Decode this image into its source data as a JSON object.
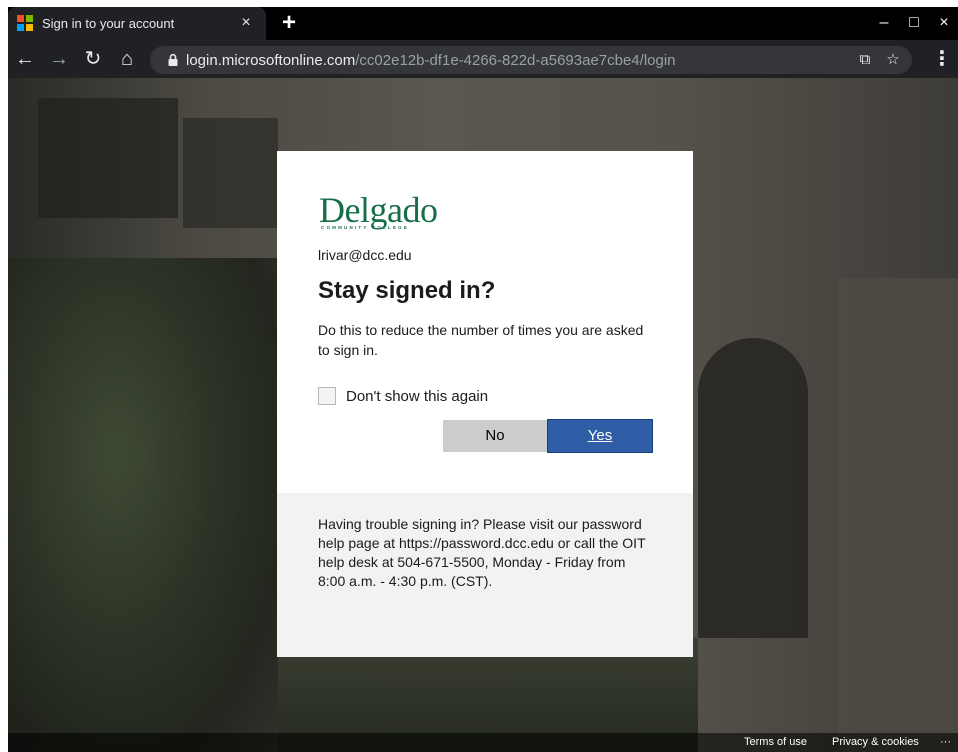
{
  "browser": {
    "tab_title": "Sign in to your account",
    "tab_close": "×",
    "new_tab": "+",
    "favicon_colors": [
      "#f25022",
      "#7fba00",
      "#00a4ef",
      "#ffb900"
    ],
    "window_controls": {
      "minimize": "–",
      "maximize": "□",
      "close": "×"
    },
    "nav": {
      "back": "←",
      "forward": "→",
      "reload": "↻",
      "home": "⌂"
    },
    "url_host": "login.microsoftonline.com",
    "url_path": "/cc02e12b-df1e-4266-822d-a5693ae7cbe4/login",
    "omnibox_icons": {
      "open_in": "⧉",
      "bookmark": "☆"
    },
    "menu": "⋮"
  },
  "dialog": {
    "logo_text": "Delgado",
    "logo_subtext": "COMMUNITY COLLEGE",
    "account_email": "lrivar@dcc.edu",
    "heading": "Stay signed in?",
    "description": "Do this to reduce the number of times you are asked to sign in.",
    "checkbox_label": "Don't show this again",
    "no_label": "No",
    "yes_label": "Yes",
    "help_text": "Having trouble signing in? Please visit our password help page at https://password.dcc.edu or call the OIT help desk at 504-671-5500, Monday - Friday from 8:00 a.m. - 4:30 p.m. (CST)."
  },
  "footer": {
    "terms": "Terms of use",
    "privacy": "Privacy & cookies",
    "more": "···"
  },
  "colors": {
    "accent_button": "#2f5ea6",
    "logo_green": "#176f4a"
  }
}
